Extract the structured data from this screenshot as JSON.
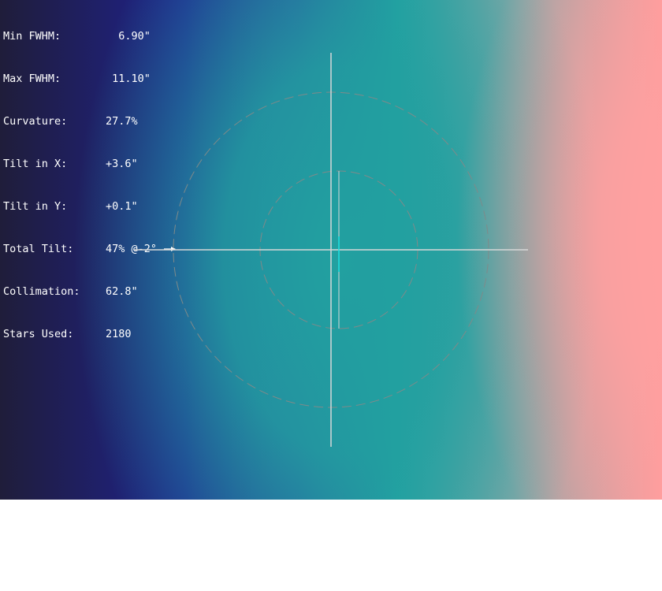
{
  "stats": [
    {
      "label": "Min FWHM:",
      "value": "  6.90\""
    },
    {
      "label": "Max FWHM:",
      "value": " 11.10\""
    },
    {
      "label": "Curvature:",
      "value": "27.7%"
    },
    {
      "label": "Tilt in X:",
      "value": "+3.6\""
    },
    {
      "label": "Tilt in Y:",
      "value": "+0.1\""
    },
    {
      "label": "Total Tilt:",
      "value": "47% @-2°"
    },
    {
      "label": "Collimation:",
      "value": "62.8\""
    },
    {
      "label": "Stars Used:",
      "value": "2180"
    }
  ],
  "icons": {
    "tilt_direction": "right-arrow-icon"
  },
  "colors": {
    "crosshair": "#d8d8d8",
    "circles": "#7f8a8a",
    "collimation_marker": "#20e0e0",
    "text": "#ffffff"
  }
}
